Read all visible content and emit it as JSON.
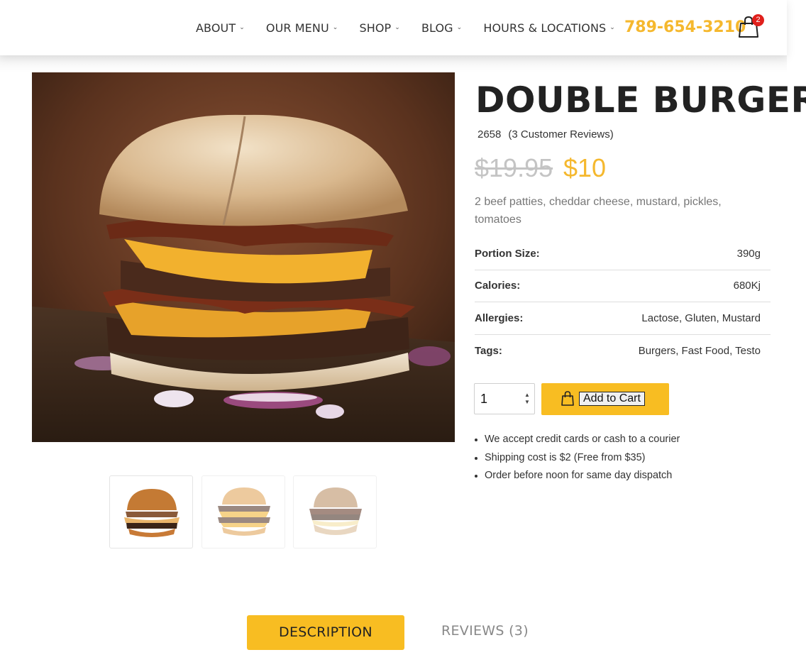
{
  "nav": {
    "items": [
      {
        "label": "ABOUT"
      },
      {
        "label": "OUR MENU"
      },
      {
        "label": "SHOP"
      },
      {
        "label": "BLOG"
      },
      {
        "label": "HOURS & LOCATIONS"
      }
    ],
    "phone": "789-654-3210",
    "cart_count": "2",
    "chevron_icon": "chevron-down-icon",
    "cart_icon": "shopping-bag-icon"
  },
  "product": {
    "title": "DOUBLE BURGER",
    "sku": "2658",
    "reviews_text": "(3 Customer Reviews)",
    "price_old": "$19.95",
    "price_new": "$10",
    "description": "2 beef patties, cheddar cheese, mustard, pickles, tomatoes",
    "specs": [
      {
        "key": "Portion Size:",
        "value": "390g"
      },
      {
        "key": "Calories:",
        "value": "680Kj"
      },
      {
        "key": "Allergies:",
        "value": "Lactose, Gluten, Mustard"
      },
      {
        "key": "Tags:",
        "value": "Burgers, Fast Food, Testo"
      }
    ],
    "quantity": "1",
    "add_to_cart_label": "Add to Cart",
    "notes": [
      "We accept credit cards or cash to a courier",
      "Shipping cost is $2 (Free from $35)",
      "Order before noon for same day dispatch"
    ]
  },
  "tabs": {
    "description": "DESCRIPTION",
    "reviews": "REVIEWS (3)"
  },
  "colors": {
    "accent": "#f8bd22",
    "phone": "#f5b82e",
    "badge": "#e0201c"
  }
}
